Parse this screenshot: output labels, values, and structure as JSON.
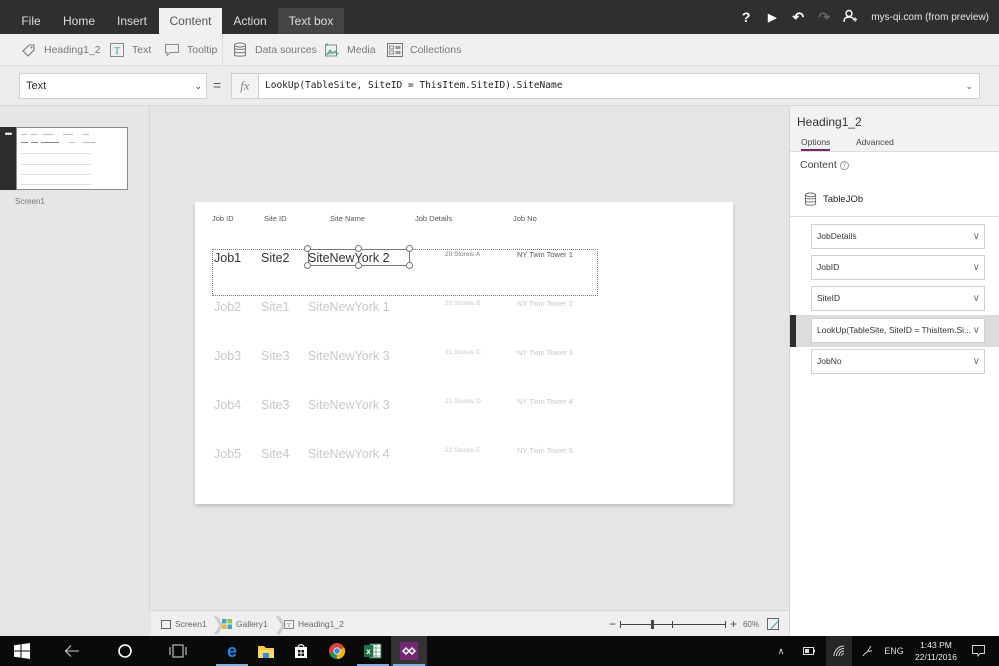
{
  "menubar": {
    "tabs": [
      {
        "label": "File"
      },
      {
        "label": "Home"
      },
      {
        "label": "Insert"
      },
      {
        "label": "Content",
        "active": true
      },
      {
        "label": "Action"
      },
      {
        "label": "Text box",
        "contextual": true
      }
    ],
    "right_icons": [
      "help-icon",
      "play-icon",
      "undo-icon",
      "redo-icon",
      "account-icon"
    ],
    "help_glyph": "?",
    "play_glyph": "▶",
    "undo_glyph": "↶",
    "redo_glyph": "↷",
    "account": "mys-qi.com (from preview)"
  },
  "ribbon": {
    "items": [
      {
        "label": "Heading1_2",
        "icon": "tag-icon"
      },
      {
        "label": "Text",
        "icon": "text-icon"
      },
      {
        "label": "Tooltip",
        "icon": "tooltip-icon"
      },
      {
        "label": "Data sources",
        "icon": "database-icon"
      },
      {
        "label": "Media",
        "icon": "media-icon"
      },
      {
        "label": "Collections",
        "icon": "collections-icon"
      }
    ]
  },
  "formula": {
    "property": "Text",
    "equals": "=",
    "fx": "fx",
    "value": "LookUp(TableSite, SiteID = ThisItem.SiteID).SiteName"
  },
  "screens": {
    "items": [
      {
        "label": "Screen1"
      }
    ],
    "handle": "•••"
  },
  "canvas": {
    "headers": [
      "Job ID",
      "Site ID",
      "Site Name",
      "Job Details",
      "Job No"
    ],
    "rows": [
      {
        "job_id": "Job1",
        "site_id": "Site2",
        "site_name": "SiteNewYork 2",
        "job_details": "20 Storeis A",
        "job_no": "NY Twin Tower 1"
      },
      {
        "job_id": "Job2",
        "site_id": "Site1",
        "site_name": "SiteNewYork 1",
        "job_details": "20 Storeis B",
        "job_no": "NY Twin Tower 2"
      },
      {
        "job_id": "Job3",
        "site_id": "Site3",
        "site_name": "SiteNewYork 3",
        "job_details": "21 Storeis C",
        "job_no": "NY Twin Tower 3"
      },
      {
        "job_id": "Job4",
        "site_id": "Site3",
        "site_name": "SiteNewYork 3",
        "job_details": "21 Storeis D",
        "job_no": "NY Twin Tower 4"
      },
      {
        "job_id": "Job5",
        "site_id": "Site4",
        "site_name": "SiteNewYork 4",
        "job_details": "22 Storeis E",
        "job_no": "NY Twin Tower 5"
      }
    ]
  },
  "breadcrumb": [
    {
      "label": "Screen1",
      "icon": "screen-icon"
    },
    {
      "label": "Gallery1",
      "icon": "gallery-icon"
    },
    {
      "label": "Heading1_2",
      "icon": "label-icon"
    }
  ],
  "zoom": {
    "minus": "−",
    "plus": "+",
    "value": "60%",
    "level_fraction": 0.3
  },
  "properties": {
    "title": "Heading1_2",
    "tabs": [
      {
        "label": "Options",
        "active": true
      },
      {
        "label": "Advanced"
      }
    ],
    "content_label": "Content",
    "help": "?",
    "data_source": "TableJOb",
    "fields": [
      {
        "value": "JobDetails"
      },
      {
        "value": "JobID"
      },
      {
        "value": "SiteID"
      },
      {
        "value": "LookUp(TableSite, SiteID = ThisItem.Si...",
        "selected": true
      },
      {
        "value": "JobNo"
      }
    ],
    "chevron": "∨"
  },
  "taskbar": {
    "apps": [
      "start-icon",
      "back-icon",
      "cortana-icon",
      "task-view-icon",
      "edge-icon",
      "file-explorer-icon",
      "store-icon",
      "chrome-icon",
      "excel-icon",
      "powerapps-icon"
    ],
    "tray": {
      "chevron": "∧",
      "language": "ENG",
      "time": "1:43 PM",
      "date": "22/11/2016"
    }
  }
}
